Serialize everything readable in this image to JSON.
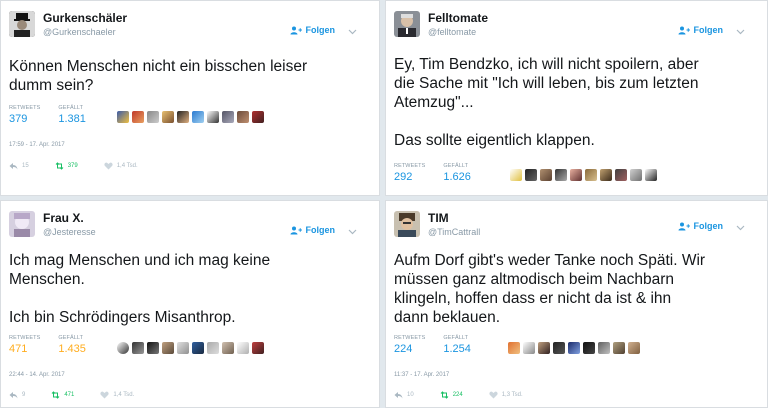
{
  "colors": {
    "accent": "#1b95e0",
    "retweet": "#17bf63",
    "muted": "#8899a6",
    "gold": "#ffad1f"
  },
  "tweets": [
    {
      "name": "Gurkenschäler",
      "handle": "@Gurkenschaeler",
      "follow_label": "Folgen",
      "text": "Können Menschen nicht ein bisschen leiser\ndumm sein?",
      "retweets_label": "RETWEETS",
      "retweets": "379",
      "likes_label": "GEFÄLLT",
      "likes": "1.381",
      "timestamp": "17:59 - 17. Apr. 2017",
      "reply_count": "15",
      "retweet_count": "379",
      "like_count": "1,4 Tsd."
    },
    {
      "name": "Felltomate",
      "handle": "@felltomate",
      "follow_label": "Folgen",
      "text": "Ey, Tim Bendzko, ich will nicht spoilern, aber\ndie Sache mit \"Ich will leben, bis zum letzten\nAtemzug\"...\n\nDas sollte eigentlich klappen.",
      "retweets_label": "RETWEETS",
      "retweets": "292",
      "likes_label": "GEFÄLLT",
      "likes": "1.626"
    },
    {
      "name": "Frau X.",
      "handle": "@Jesteresse",
      "follow_label": "Folgen",
      "text": "Ich mag Menschen und ich mag keine\nMenschen.\n\nIch bin Schrödingers Misanthrop.",
      "retweets_label": "RETWEETS",
      "retweets": "471",
      "likes_label": "GEFÄLLT",
      "likes": "1.435",
      "timestamp": "22:44 - 14. Apr. 2017",
      "reply_count": "9",
      "retweet_count": "471",
      "like_count": "1,4 Tsd."
    },
    {
      "name": "TIM",
      "handle": "@TimCattrall",
      "follow_label": "Folgen",
      "text": "Aufm Dorf gibt's weder Tanke noch Späti. Wir\nmüssen ganz altmodisch beim Nachbarn\nklingeln, hoffen dass er nicht da ist & ihn\ndann beklauen.",
      "retweets_label": "RETWEETS",
      "retweets": "224",
      "likes_label": "GEFÄLLT",
      "likes": "1.254",
      "timestamp": "11:37 - 17. Apr. 2017",
      "reply_count": "10",
      "retweet_count": "224",
      "like_count": "1,3 Tsd."
    }
  ]
}
